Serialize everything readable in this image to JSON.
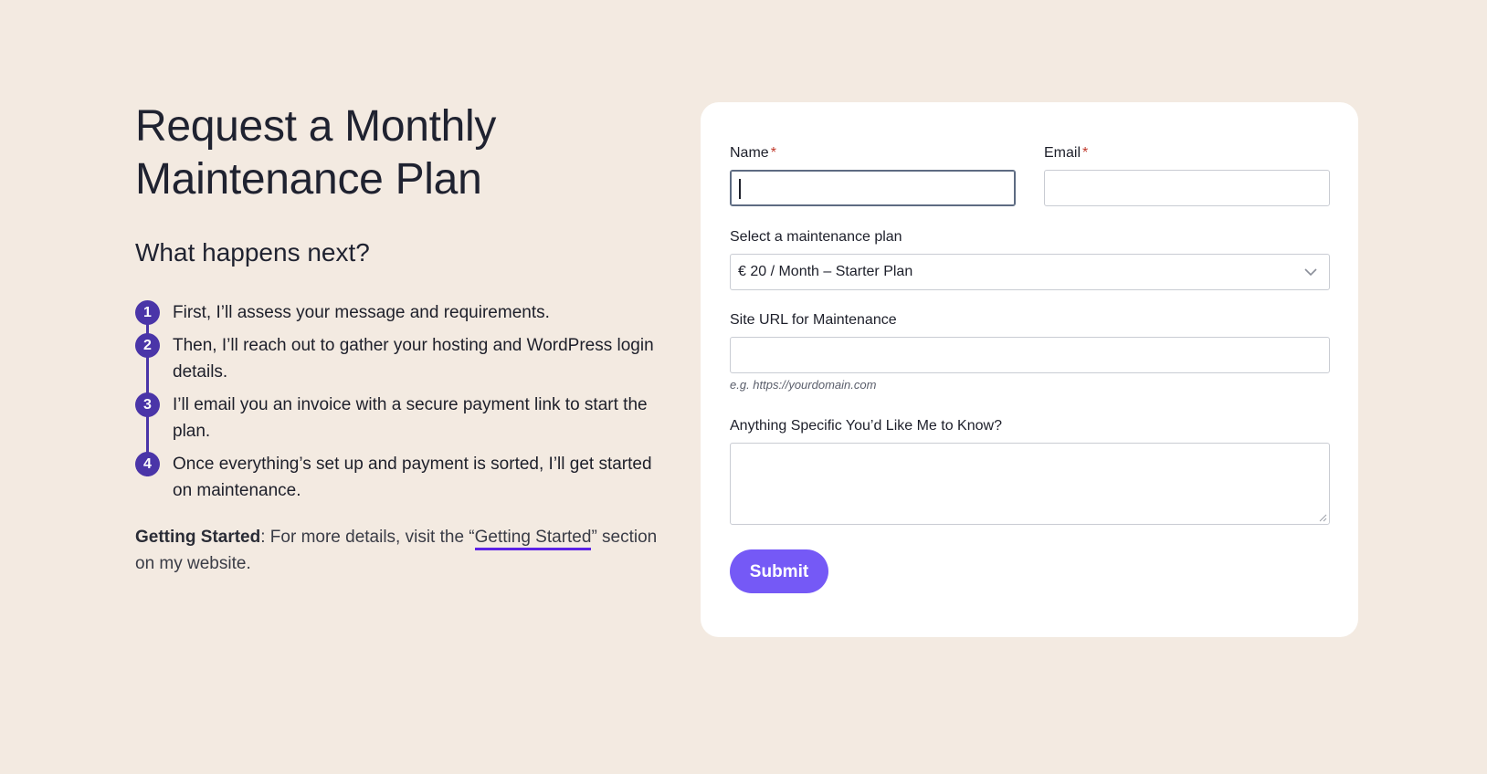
{
  "left": {
    "title_line1": "Request a Monthly",
    "title_line2": "Maintenance Plan",
    "subtitle": "What happens next?",
    "steps": [
      {
        "number": "1",
        "text": "First, I’ll assess your message and requirements."
      },
      {
        "number": "2",
        "text": "Then, I’ll reach out to gather your hosting and WordPress login details."
      },
      {
        "number": "3",
        "text": "I’ll email you an invoice with a secure payment link to start the plan."
      },
      {
        "number": "4",
        "text": "Once everything’s set up and payment is sorted, I’ll get started on maintenance."
      }
    ],
    "note": {
      "bold": "Getting Started",
      "text_before_link": ": For more details, visit the “",
      "link_text": "Getting Started",
      "text_after_link": "” section on my website."
    }
  },
  "form": {
    "name_label": "Name",
    "email_label": "Email",
    "required_mark": "*",
    "name_value": "",
    "email_value": "",
    "plan_label": "Select a maintenance plan",
    "plan_selected": "€ 20 / Month – Starter Plan",
    "site_url_label": "Site URL for Maintenance",
    "site_url_value": "",
    "site_url_hint": "e.g. https://yourdomain.com",
    "message_label": "Anything Specific You’d Like Me to Know?",
    "message_value": "",
    "submit_label": "Submit"
  },
  "colors": {
    "background": "#f3eae1",
    "accent_step": "#4a35a8",
    "link_underline": "#5b22e6",
    "submit": "#7559f6",
    "required": "#c0392b"
  },
  "icons": {
    "select": "chevron-down-icon",
    "textarea": "resize-handle-icon"
  }
}
